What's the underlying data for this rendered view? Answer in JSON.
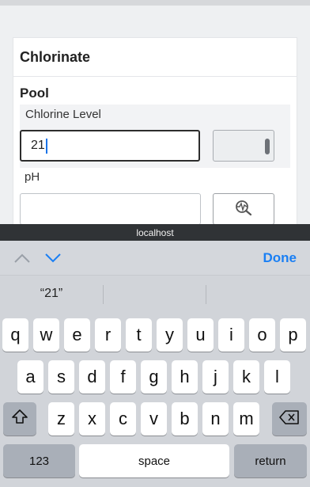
{
  "form": {
    "title": "Chlorinate",
    "section": "Pool",
    "chlorine_label": "Chlorine Level",
    "chlorine_value": "21",
    "ph_label": "pH",
    "ph_value": ""
  },
  "browser": {
    "url": "localhost"
  },
  "accessory": {
    "done_label": "Done"
  },
  "keyboard": {
    "suggestion": "“21”",
    "row1": [
      "q",
      "w",
      "e",
      "r",
      "t",
      "y",
      "u",
      "i",
      "o",
      "p"
    ],
    "row2": [
      "a",
      "s",
      "d",
      "f",
      "g",
      "h",
      "j",
      "k",
      "l"
    ],
    "row3": [
      "z",
      "x",
      "c",
      "v",
      "b",
      "n",
      "m"
    ],
    "numbers_label": "123",
    "space_label": "space",
    "return_label": "return"
  },
  "colors": {
    "accent": "#1a7ff4",
    "caret": "#1a73e8",
    "url_bar": "#303336"
  }
}
